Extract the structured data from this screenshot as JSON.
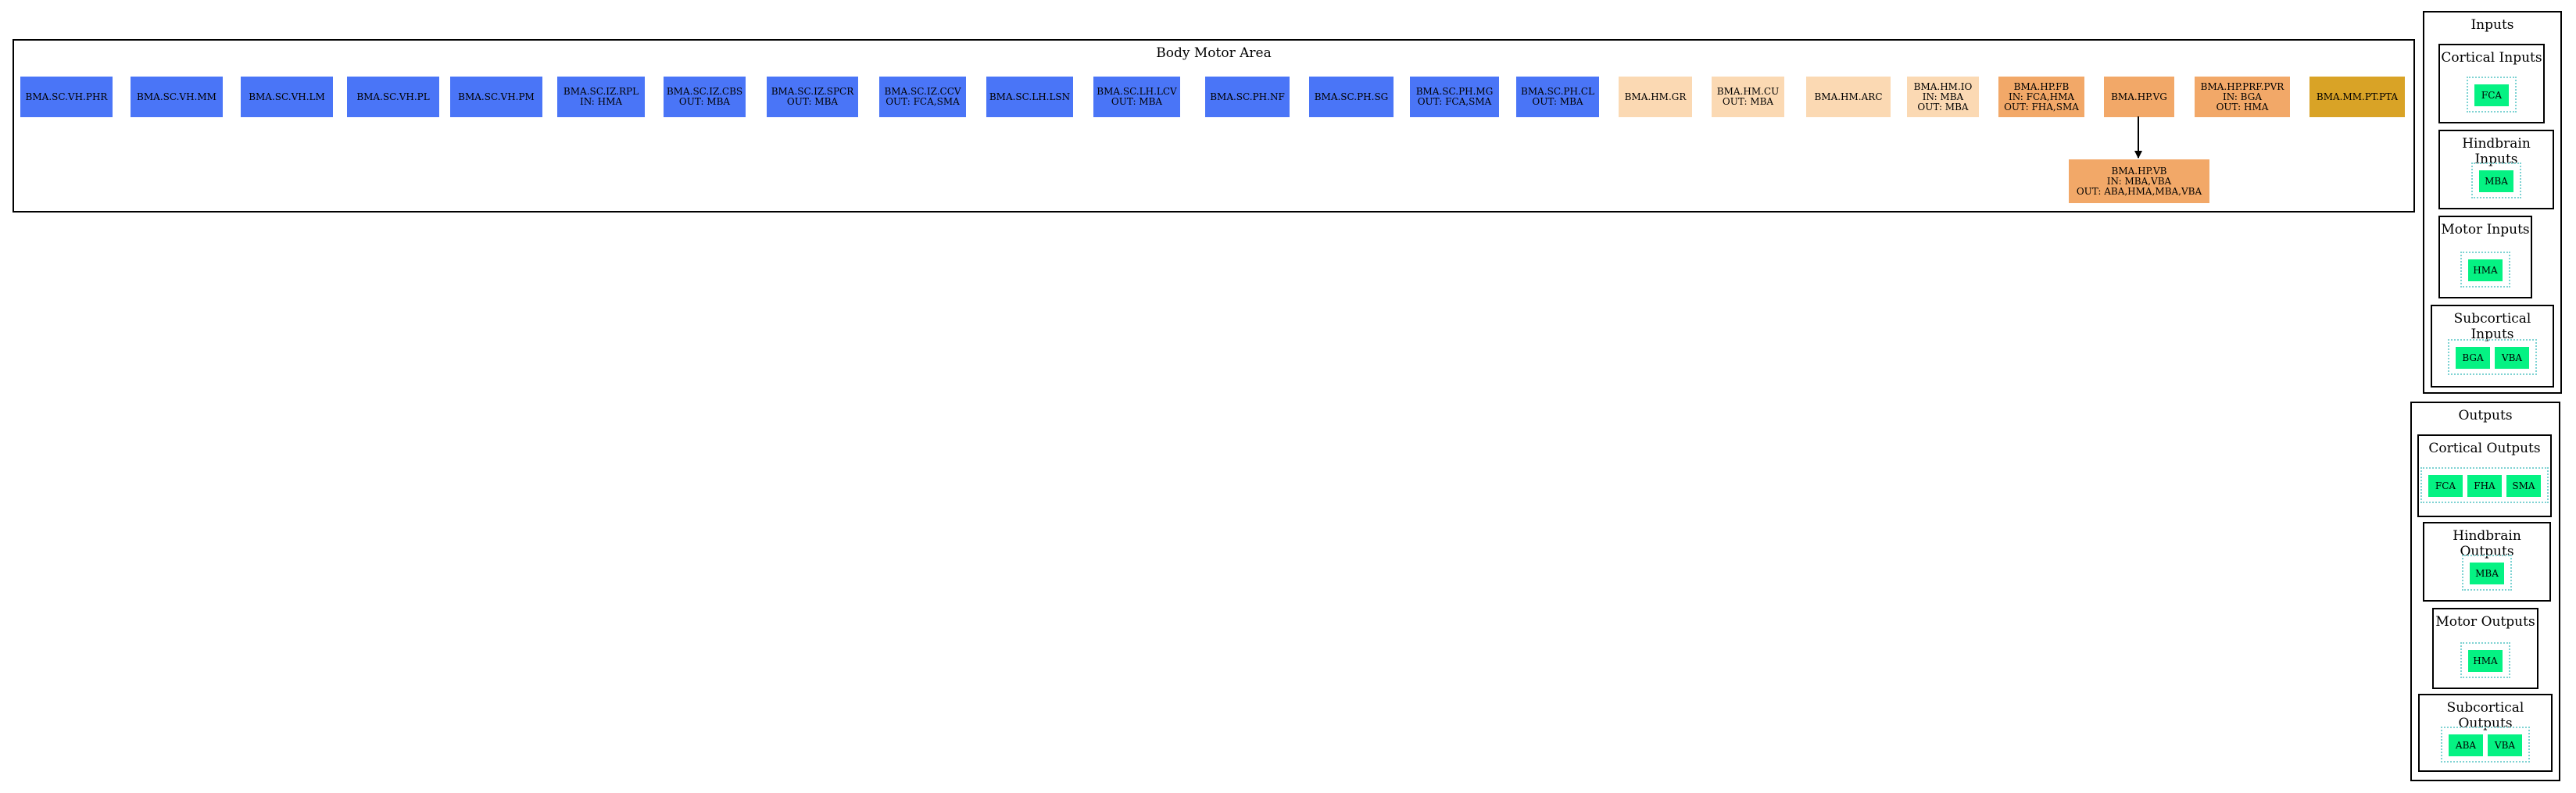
{
  "main": {
    "title": "Body Motor Area",
    "row1": [
      {
        "lines": [
          "BMA.SC.VH.PHR"
        ],
        "color": "#4a75f7"
      },
      {
        "lines": [
          "BMA.SC.VH.MM"
        ],
        "color": "#4a75f7"
      },
      {
        "lines": [
          "BMA.SC.VH.LM"
        ],
        "color": "#4a75f7"
      },
      {
        "lines": [
          "BMA.SC.VH.PL"
        ],
        "color": "#4a75f7"
      },
      {
        "lines": [
          "BMA.SC.VH.PM"
        ],
        "color": "#4a75f7"
      },
      {
        "lines": [
          "BMA.SC.IZ.RPL",
          "IN: HMA"
        ],
        "color": "#4a75f7"
      },
      {
        "lines": [
          "BMA.SC.IZ.CBS",
          "OUT: MBA"
        ],
        "color": "#4a75f7"
      },
      {
        "lines": [
          "BMA.SC.IZ.SPCR",
          "OUT: MBA"
        ],
        "color": "#4a75f7"
      },
      {
        "lines": [
          "BMA.SC.IZ.CCV",
          "OUT: FCA,SMA"
        ],
        "color": "#4a75f7"
      },
      {
        "lines": [
          "BMA.SC.LH.LSN"
        ],
        "color": "#4a75f7"
      },
      {
        "lines": [
          "BMA.SC.LH.LCV",
          "OUT: MBA"
        ],
        "color": "#4a75f7"
      },
      {
        "lines": [
          "BMA.SC.PH.NF"
        ],
        "color": "#4a75f7"
      },
      {
        "lines": [
          "BMA.SC.PH.SG"
        ],
        "color": "#4a75f7"
      },
      {
        "lines": [
          "BMA.SC.PH.MG",
          "OUT: FCA,SMA"
        ],
        "color": "#4a75f7"
      },
      {
        "lines": [
          "BMA.SC.PH.CL",
          "OUT: MBA"
        ],
        "color": "#4a75f7"
      },
      {
        "lines": [
          "BMA.HM.GR"
        ],
        "color": "#fbd9b3"
      },
      {
        "lines": [
          "BMA.HM.CU",
          "OUT: MBA"
        ],
        "color": "#fbd9b3"
      },
      {
        "lines": [
          "BMA.HM.ARC"
        ],
        "color": "#fbd9b3"
      },
      {
        "lines": [
          "BMA.HM.IO",
          "IN: MBA",
          "OUT: MBA"
        ],
        "color": "#fbd9b3"
      },
      {
        "lines": [
          "BMA.HP.FB",
          "IN: FCA,HMA",
          "OUT: FHA,SMA"
        ],
        "color": "#f2a868"
      },
      {
        "lines": [
          "BMA.HP.VG"
        ],
        "color": "#f2a868"
      },
      {
        "lines": [
          "BMA.HP.PRF.PVR",
          "IN: BGA",
          "OUT: HMA"
        ],
        "color": "#f2a868"
      },
      {
        "lines": [
          "BMA.MM.PT.PTA"
        ],
        "color": "#d9a326"
      }
    ],
    "child": {
      "lines": [
        "BMA.HP.VB",
        "IN: MBA,VBA",
        "OUT: ABA,HMA,MBA,VBA"
      ],
      "color": "#f2a868"
    }
  },
  "inputs": {
    "title": "Inputs",
    "groups": [
      {
        "title": "Cortical Inputs",
        "nodes": [
          "FCA"
        ]
      },
      {
        "title": "Hindbrain Inputs",
        "nodes": [
          "MBA"
        ]
      },
      {
        "title": "Motor Inputs",
        "nodes": [
          "HMA"
        ]
      },
      {
        "title": "Subcortical Inputs",
        "nodes": [
          "BGA",
          "VBA"
        ]
      }
    ]
  },
  "outputs": {
    "title": "Outputs",
    "groups": [
      {
        "title": "Cortical Outputs",
        "nodes": [
          "FCA",
          "FHA",
          "SMA"
        ]
      },
      {
        "title": "Hindbrain Outputs",
        "nodes": [
          "MBA"
        ]
      },
      {
        "title": "Motor Outputs",
        "nodes": [
          "HMA"
        ]
      },
      {
        "title": "Subcortical Outputs",
        "nodes": [
          "ABA",
          "VBA"
        ]
      }
    ]
  }
}
